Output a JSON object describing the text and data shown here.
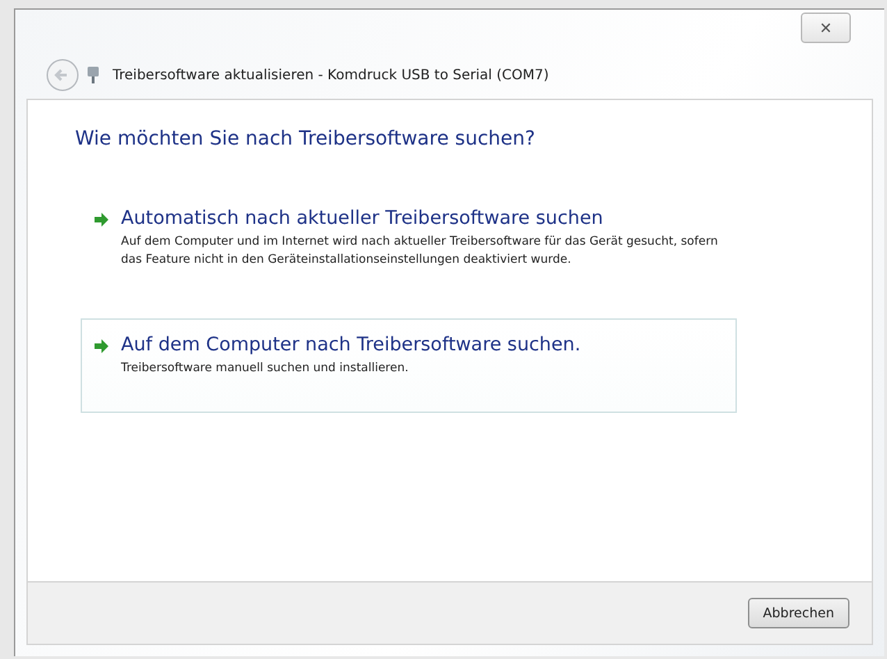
{
  "window": {
    "title": "Treibersoftware aktualisieren - Komdruck USB to Serial (COM7)",
    "close": "✕"
  },
  "heading": "Wie möchten Sie nach Treibersoftware suchen?",
  "options": [
    {
      "title": "Automatisch nach aktueller Treibersoftware suchen",
      "description": "Auf dem Computer und im Internet wird nach aktueller Treibersoftware für das Gerät gesucht, sofern das Feature nicht in den Geräteinstallationseinstellungen deaktiviert wurde.",
      "selected": false
    },
    {
      "title": "Auf dem Computer nach Treibersoftware suchen.",
      "description": "Treibersoftware manuell suchen und installieren.",
      "selected": true
    }
  ],
  "buttons": [
    "Abbrechen"
  ]
}
